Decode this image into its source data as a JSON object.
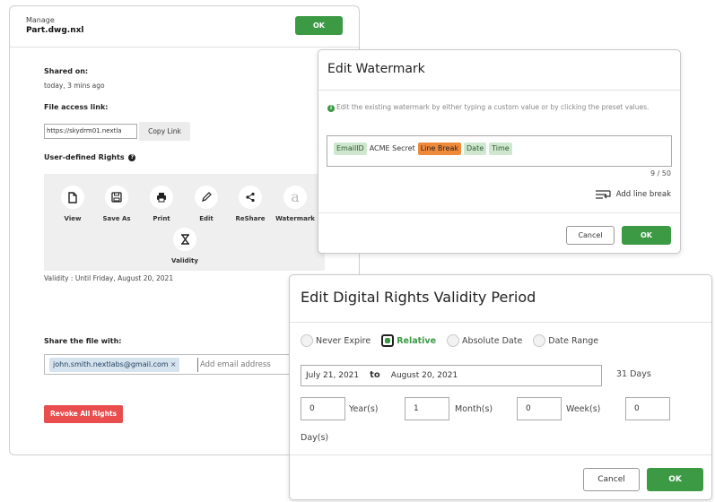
{
  "manage": {
    "header_label": "Manage",
    "file_name": "Part.dwg.nxl",
    "ok_label": "OK",
    "shared_on_title": "Shared on:",
    "shared_on_value": "today, 3 mins ago",
    "file_access_title": "File access link:",
    "file_access_link": "https://skydrm01.nextla",
    "copy_link_label": "Copy Link",
    "rights_title": "User-defined Rights",
    "rights": [
      {
        "label": "View",
        "icon": "file-icon"
      },
      {
        "label": "Save As",
        "icon": "save-icon"
      },
      {
        "label": "Print",
        "icon": "printer-icon"
      },
      {
        "label": "Edit",
        "icon": "pencil-icon"
      },
      {
        "label": "ReShare",
        "icon": "share-icon"
      },
      {
        "label": "Watermark",
        "icon": "watermark-icon"
      },
      {
        "label": "Validity",
        "icon": "hourglass-icon"
      }
    ],
    "validity_text": "Validity : Until Friday, August 20, 2021",
    "share_title": "Share the file with:",
    "share_chip": "john.smith.nextlabs@gmail.com",
    "share_chip_remove": "×",
    "share_placeholder": "Add email address",
    "revoke_label": "Revoke All Rights"
  },
  "watermark": {
    "title": "Edit Watermark",
    "info_icon": "i",
    "info_text": "Edit the existing watermark by either typing a custom value or by clicking the preset values.",
    "tokens": [
      {
        "text": "EmailID",
        "kind": "preset"
      },
      {
        "text": "ACME Secret",
        "kind": "text"
      },
      {
        "text": "Line Break",
        "kind": "linebreak"
      },
      {
        "text": "Date",
        "kind": "preset"
      },
      {
        "text": "Time",
        "kind": "preset"
      }
    ],
    "char_count": "9 / 50",
    "add_line_break_label": "Add line break",
    "cancel_label": "Cancel",
    "ok_label": "OK"
  },
  "validity": {
    "title": "Edit Digital Rights Validity Period",
    "options": [
      {
        "label": "Never Expire",
        "selected": false
      },
      {
        "label": "Relative",
        "selected": true
      },
      {
        "label": "Absolute Date",
        "selected": false
      },
      {
        "label": "Date Range",
        "selected": false
      }
    ],
    "start_date": "July 21, 2021",
    "to_label": "to",
    "end_date": "August 20, 2021",
    "days_count": "31 Days",
    "years_value": "0",
    "years_label": "Year(s)",
    "months_value": "1",
    "months_label": "Month(s)",
    "weeks_value": "0",
    "weeks_label": "Week(s)",
    "days_value": "0",
    "days_label": "Day(s)",
    "cancel_label": "Cancel",
    "ok_label": "OK"
  },
  "colors": {
    "accent_green": "#3c9a45",
    "danger_red": "#e94d4d",
    "linebreak_orange": "#f08a3b",
    "preset_green_bg": "#cfe7cf"
  }
}
